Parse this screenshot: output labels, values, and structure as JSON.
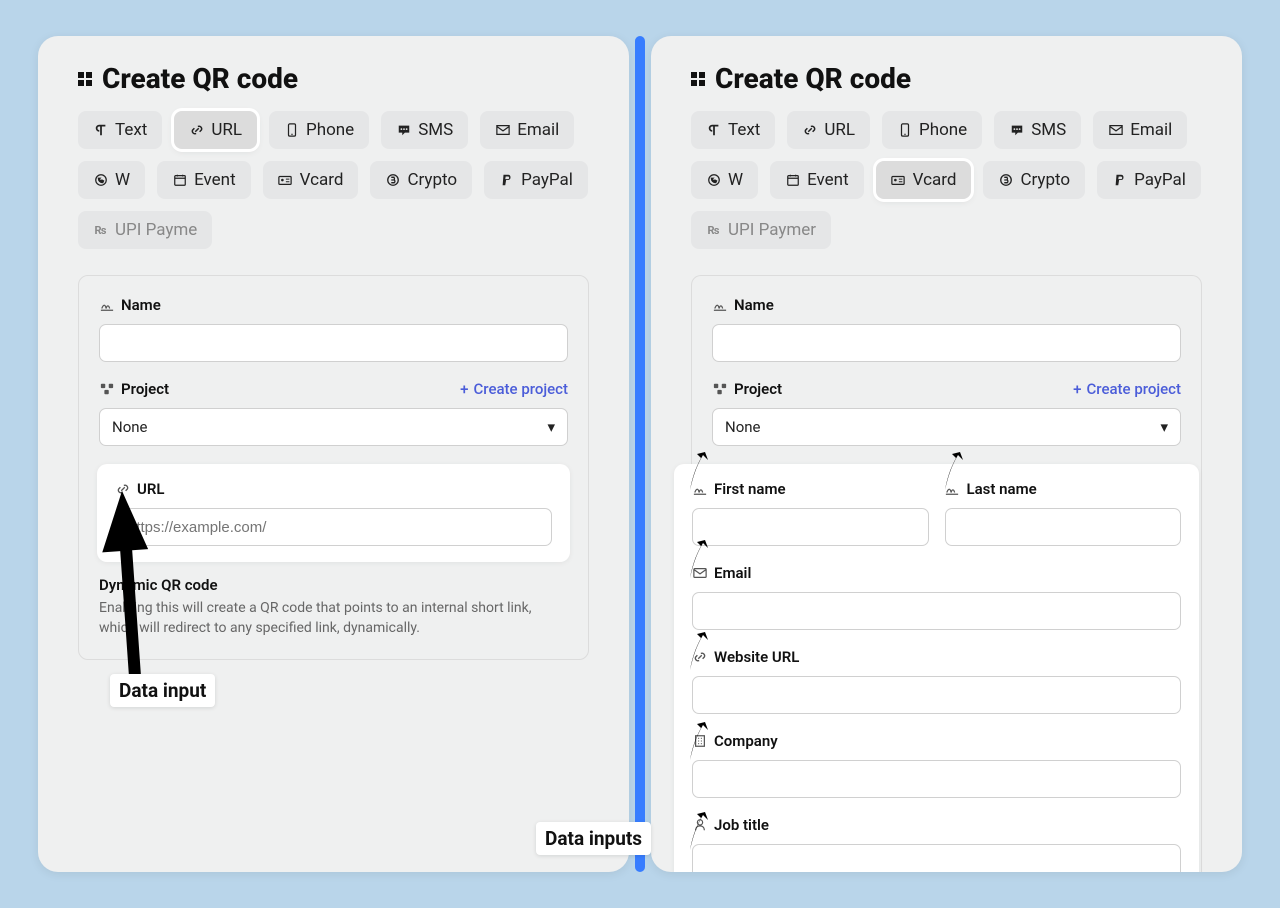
{
  "left": {
    "title": "Create QR code",
    "tabs": [
      {
        "label": "Text",
        "icon": "para"
      },
      {
        "label": "URL",
        "icon": "link",
        "active": true
      },
      {
        "label": "Phone",
        "icon": "phone"
      },
      {
        "label": "SMS",
        "icon": "sms"
      },
      {
        "label": "Email",
        "icon": "env"
      },
      {
        "label": "W",
        "icon": "wa",
        "cut": true
      },
      {
        "label": "Event",
        "icon": "cal"
      },
      {
        "label": "Vcard",
        "icon": "card"
      },
      {
        "label": "Crypto",
        "icon": "crypto"
      },
      {
        "label": "PayPal",
        "icon": "pp"
      },
      {
        "label": "UPI Payme",
        "icon": "upi",
        "cut": true
      }
    ],
    "name_label": "Name",
    "project_label": "Project",
    "create_project": "Create project",
    "project_value": "None",
    "url_label": "URL",
    "url_placeholder": "https://example.com/",
    "dynamic_title": "Dynamic QR code",
    "dynamic_desc": "Enabling this will create a QR code that points to an internal short link, which will redirect to any specified link, dynamically.",
    "callout": "Data input"
  },
  "right": {
    "title": "Create QR code",
    "tabs": [
      {
        "label": "Text",
        "icon": "para"
      },
      {
        "label": "URL",
        "icon": "link"
      },
      {
        "label": "Phone",
        "icon": "phone"
      },
      {
        "label": "SMS",
        "icon": "sms"
      },
      {
        "label": "Email",
        "icon": "env"
      },
      {
        "label": "W",
        "icon": "wa",
        "cut": true
      },
      {
        "label": "Event",
        "icon": "cal"
      },
      {
        "label": "Vcard",
        "icon": "card",
        "active": true
      },
      {
        "label": "Crypto",
        "icon": "crypto"
      },
      {
        "label": "PayPal",
        "icon": "pp"
      },
      {
        "label": "UPI Paymer",
        "icon": "upi",
        "cut": true
      }
    ],
    "name_label": "Name",
    "project_label": "Project",
    "create_project": "Create project",
    "project_value": "None",
    "fields": {
      "first_name": "First name",
      "last_name": "Last name",
      "email": "Email",
      "website": "Website URL",
      "company": "Company",
      "job_title": "Job title"
    },
    "callout": "Data inputs"
  }
}
